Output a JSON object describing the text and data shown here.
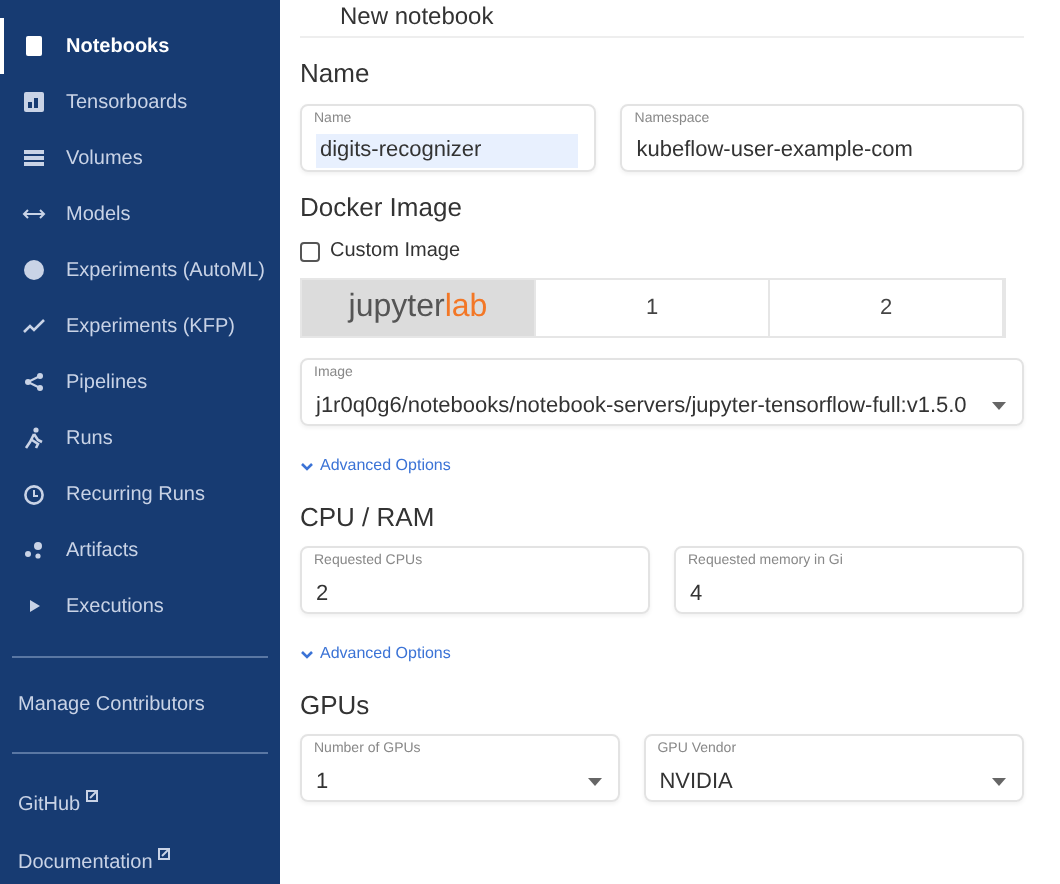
{
  "sidebar": {
    "items": [
      {
        "label": "Notebooks",
        "selected": true
      },
      {
        "label": "Tensorboards",
        "selected": false
      },
      {
        "label": "Volumes",
        "selected": false
      },
      {
        "label": "Models",
        "selected": false
      },
      {
        "label": "Experiments (AutoML)",
        "selected": false
      },
      {
        "label": "Experiments (KFP)",
        "selected": false
      },
      {
        "label": "Pipelines",
        "selected": false
      },
      {
        "label": "Runs",
        "selected": false
      },
      {
        "label": "Recurring Runs",
        "selected": false
      },
      {
        "label": "Artifacts",
        "selected": false
      },
      {
        "label": "Executions",
        "selected": false
      }
    ],
    "manage": "Manage Contributors",
    "links": [
      {
        "label": "GitHub"
      },
      {
        "label": "Documentation"
      }
    ]
  },
  "page_title": "New notebook",
  "sections": [
    {
      "kind": "fields",
      "title": "Name",
      "fields": [
        {
          "label": "Name",
          "value": "digits-recognizer",
          "highlighted": true
        },
        {
          "label": "Namespace",
          "value": "kubeflow-user-example-com",
          "highlighted": false
        }
      ]
    },
    {
      "kind": "docker",
      "title": "Docker Image",
      "custom_image": {
        "label": "Custom Image",
        "checked": false
      },
      "tiles": [
        {
          "label": "jupyter",
          "accent": "lab",
          "selected": true
        },
        {
          "label": "1",
          "selected": false
        },
        {
          "label": "2",
          "selected": false
        }
      ],
      "image": {
        "label": "Image",
        "value": "j1r0q0g6/notebooks/notebook-servers/jupyter-tensorflow-full:v1.5.0"
      },
      "advanced": "Advanced Options"
    },
    {
      "kind": "fields",
      "title": "CPU / RAM",
      "fields": [
        {
          "label": "Requested CPUs",
          "value": "2"
        },
        {
          "label": "Requested memory in Gi",
          "value": "4"
        }
      ],
      "advanced": "Advanced Options"
    },
    {
      "kind": "selects",
      "title": "GPUs",
      "fields": [
        {
          "label": "Number of GPUs",
          "value": "1"
        },
        {
          "label": "GPU Vendor",
          "value": "NVIDIA"
        }
      ]
    }
  ]
}
